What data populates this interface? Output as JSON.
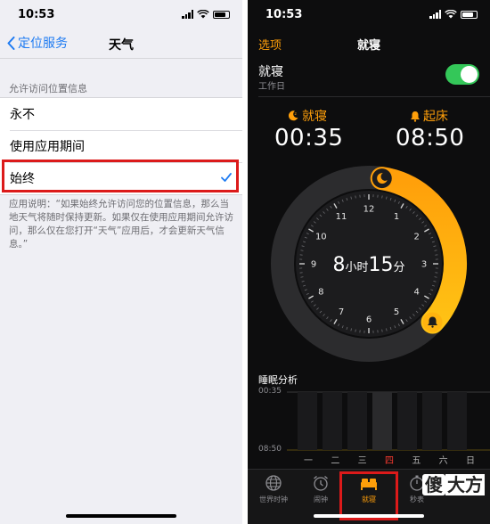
{
  "left": {
    "status_time": "10:53",
    "nav": {
      "back_label": "定位服务",
      "title": "天气"
    },
    "section_header": "允许访问位置信息",
    "options": [
      {
        "label": "永不",
        "selected": false
      },
      {
        "label": "使用应用期间",
        "selected": false
      },
      {
        "label": "始终",
        "selected": true
      }
    ],
    "footnote": "应用说明：“如果始终允许访问您的位置信息，那么当地天气将随时保持更新。如果仅在使用应用期间允许访问，那么仅在您打开“天气”应用后，才会更新天气信息。”"
  },
  "right": {
    "status_time": "10:53",
    "nav": {
      "left_label": "选项",
      "title": "就寝"
    },
    "bedtime": {
      "title": "就寝",
      "subtitle": "工作日",
      "enabled": true
    },
    "sleep_label": "就寝",
    "sleep_time": "00:35",
    "wake_label": "起床",
    "wake_time": "08:50",
    "duration": {
      "hours": "8",
      "hours_unit": "小时",
      "minutes": "15",
      "minutes_unit": "分"
    },
    "dial_numbers": [
      "12",
      "1",
      "2",
      "3",
      "4",
      "5",
      "6",
      "7",
      "8",
      "9",
      "10",
      "11"
    ],
    "analysis": {
      "title": "睡眠分析",
      "top_label": "00:35",
      "bottom_label": "08:50",
      "days": [
        "一",
        "二",
        "三",
        "四",
        "五",
        "六",
        "日"
      ],
      "today_index": 3
    },
    "tabs": [
      {
        "label": "世界时钟",
        "icon": "globe-icon",
        "active": false
      },
      {
        "label": "闹钟",
        "icon": "alarm-clock-icon",
        "active": false
      },
      {
        "label": "就寝",
        "icon": "bed-icon",
        "active": true
      },
      {
        "label": "秒表",
        "icon": "stopwatch-icon",
        "active": false
      }
    ],
    "watermark": {
      "char": "傻",
      "text": "大方"
    }
  },
  "colors": {
    "ios_blue": "#1e7bf2",
    "highlight_red": "#dc1a1a",
    "orange": "#ff9f0a",
    "yellow": "#ffd60a",
    "toggle_green": "#34c759",
    "today_red": "#ff3b30"
  }
}
